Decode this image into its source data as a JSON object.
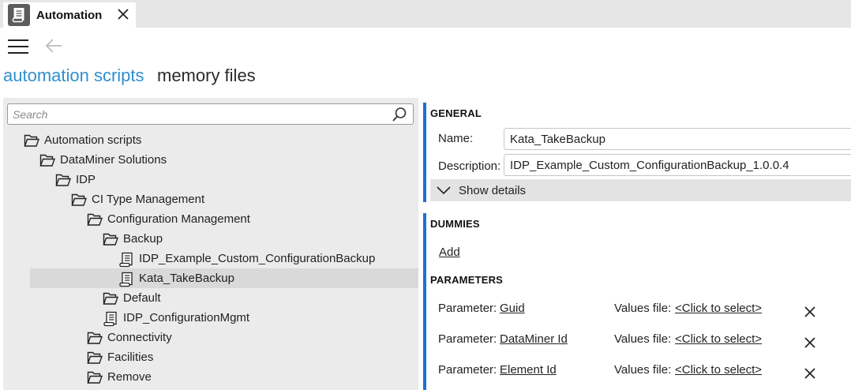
{
  "window": {
    "tab_title": "Automation",
    "tab_icon": "script-icon",
    "close_icon": "close-icon"
  },
  "toolbar": {
    "menu_icon": "hamburger-menu-icon",
    "back_icon": "back-arrow-icon"
  },
  "subtabs": [
    {
      "label": "automation scripts",
      "active": true
    },
    {
      "label": "memory files",
      "active": false
    }
  ],
  "search": {
    "placeholder": "Search",
    "icon": "search-icon"
  },
  "tree": [
    {
      "label": "Automation scripts",
      "type": "folder",
      "depth": 0,
      "selected": false
    },
    {
      "label": "DataMiner Solutions",
      "type": "folder",
      "depth": 1,
      "selected": false
    },
    {
      "label": "IDP",
      "type": "folder",
      "depth": 2,
      "selected": false
    },
    {
      "label": "CI Type Management",
      "type": "folder",
      "depth": 3,
      "selected": false
    },
    {
      "label": "Configuration Management",
      "type": "folder",
      "depth": 4,
      "selected": false
    },
    {
      "label": "Backup",
      "type": "folder",
      "depth": 5,
      "selected": false
    },
    {
      "label": "IDP_Example_Custom_ConfigurationBackup",
      "type": "script",
      "depth": 6,
      "selected": false
    },
    {
      "label": "Kata_TakeBackup",
      "type": "script",
      "depth": 6,
      "selected": true
    },
    {
      "label": "Default",
      "type": "folder",
      "depth": 5,
      "selected": false
    },
    {
      "label": "IDP_ConfigurationMgmt",
      "type": "script",
      "depth": 5,
      "selected": false
    },
    {
      "label": "Connectivity",
      "type": "folder",
      "depth": 4,
      "selected": false
    },
    {
      "label": "Facilities",
      "type": "folder",
      "depth": 4,
      "selected": false
    },
    {
      "label": "Remove",
      "type": "folder",
      "depth": 4,
      "selected": false
    }
  ],
  "general": {
    "title": "GENERAL",
    "name_label": "Name:",
    "name_value": "Kata_TakeBackup",
    "description_label": "Description:",
    "description_value": "IDP_Example_Custom_ConfigurationBackup_1.0.0.4",
    "show_details_label": "Show details"
  },
  "dummies": {
    "title": "DUMMIES",
    "add_label": "Add"
  },
  "parameters": {
    "title": "PARAMETERS",
    "param_label": "Parameter:",
    "values_label": "Values file:",
    "items": [
      {
        "name": "Guid",
        "values_file": "<Click to select>"
      },
      {
        "name": "DataMiner Id",
        "values_file": "<Click to select>"
      },
      {
        "name": "Element Id",
        "values_file": "<Click to select>"
      }
    ]
  },
  "colors": {
    "accent": "#2f8fce",
    "section_bar": "#1f6fd0",
    "tree_bg": "#ebebeb",
    "selected_row": "#d9d9d9"
  }
}
